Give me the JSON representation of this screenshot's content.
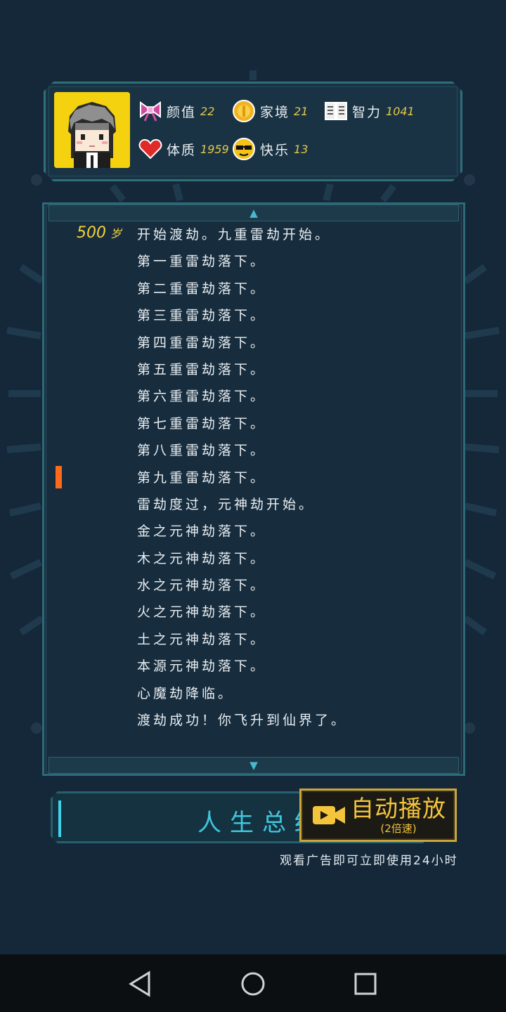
{
  "stats": {
    "items": [
      {
        "icon": "bow-icon",
        "label": "颜值",
        "value": "22"
      },
      {
        "icon": "coin-icon",
        "label": "家境",
        "value": "21"
      },
      {
        "icon": "book-icon",
        "label": "智力",
        "value": "1041"
      },
      {
        "icon": "heart-icon",
        "label": "体质",
        "value": "1959"
      },
      {
        "icon": "sunglasses-emoji-icon",
        "label": "快乐",
        "value": "13"
      }
    ]
  },
  "log": {
    "age": "500",
    "age_unit": "岁",
    "entries": [
      "开始渡劫。九重雷劫开始。",
      "第一重雷劫落下。",
      "第二重雷劫落下。",
      "第三重雷劫落下。",
      "第四重雷劫落下。",
      "第五重雷劫落下。",
      "第六重雷劫落下。",
      "第七重雷劫落下。",
      "第八重雷劫落下。",
      "第九重雷劫落下。",
      "雷劫度过，元神劫开始。",
      "金之元神劫落下。",
      "木之元神劫落下。",
      "水之元神劫落下。",
      "火之元神劫落下。",
      "土之元神劫落下。",
      "本源元神劫落下。",
      "心魔劫降临。",
      "渡劫成功！你飞升到仙界了。"
    ]
  },
  "buttons": {
    "summary": "人生总结",
    "autoplay": "自动播放",
    "autoplay_sub": "(2倍速)"
  },
  "ad_hint": "观看广告即可立即使用24小时",
  "colors": {
    "background": "#14283a",
    "accent_cyan": "#3fc6dc",
    "age_yellow": "#f4d23a",
    "cursor_orange": "#ff6a1a",
    "gold": "#c9a637"
  }
}
